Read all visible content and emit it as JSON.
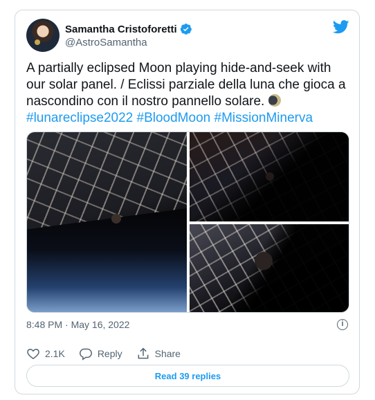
{
  "tweet": {
    "author_name": "Samantha Cristoforetti",
    "author_handle": "@AstroSamantha",
    "text_main": "A partially eclipsed Moon playing hide-and-seek with our solar panel. / Eclissi parziale della luna che gioca a nascondino con il nostro pannello solare.",
    "hashtags": [
      "#lunareclipse2022",
      "#BloodMoon",
      "#MissionMinerva"
    ],
    "timestamp": "8:48 PM · May 16, 2022"
  },
  "actions": {
    "like_count": "2.1K",
    "reply_label": "Reply",
    "share_label": "Share"
  },
  "footer": {
    "read_replies_label": "Read 39 replies"
  },
  "colors": {
    "accent": "#1d9bf0",
    "muted": "#536471",
    "border": "#cfd9de"
  },
  "icons": [
    "verified-badge-icon",
    "twitter-bird-icon",
    "moon-emoji-icon",
    "info-icon",
    "heart-icon",
    "reply-icon",
    "share-icon"
  ]
}
